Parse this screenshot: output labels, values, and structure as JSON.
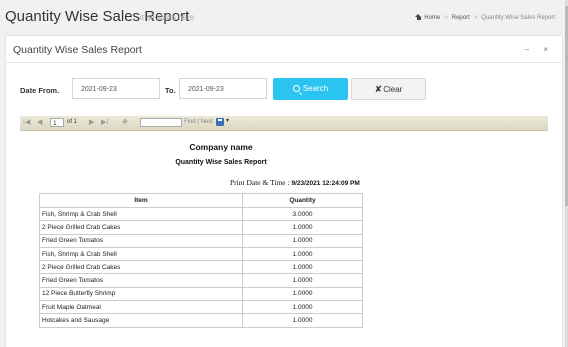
{
  "header": {
    "title": "Quantity Wise Sales Report",
    "subtitle": "it all starts here",
    "breadcrumb": [
      "Home",
      "Report",
      "Quantity Wise Sales Report"
    ]
  },
  "panel": {
    "title": "Quantity Wise Sales Report",
    "tools": "– ×"
  },
  "filters": {
    "date_from_label": "Date From.",
    "date_from_value": "2021-09-23",
    "to_label": "To.",
    "to_value": "2021-09-23",
    "search_label": "Search",
    "clear_label": "Clear"
  },
  "viewer": {
    "first": "I◀",
    "prev": "◀",
    "page": "1",
    "of_text": "of 1",
    "next": "▶",
    "last": "▶I",
    "refresh": "✥",
    "find_next": "Find | Next",
    "export_caret": "▾"
  },
  "report": {
    "company": "Company name",
    "title": "Quantity Wise Sales Report",
    "print_label": "Print Date & Time :",
    "print_value": "9/23/2021 12:24:09 PM",
    "columns": [
      "Item",
      "Quantity"
    ],
    "rows": [
      [
        "Fish, Shrimp & Crab Shell",
        "3.0000"
      ],
      [
        "2 Piece Grilled Crab Cakes",
        "1.0000"
      ],
      [
        "Fried Green Tomatos",
        "1.0000"
      ],
      [
        "Fish, Shrimp & Crab Shell",
        "1.0000"
      ],
      [
        "2 Piece Grilled Crab Cakes",
        "1.0000"
      ],
      [
        "Fried Green Tomatos",
        "1.0000"
      ],
      [
        "12 Piece Butterfly Shrimp",
        "1.0000"
      ],
      [
        "Fruit Maple Oatmeal",
        "1.0000"
      ],
      [
        "Hotcakes and Sausage",
        "1.0000"
      ]
    ]
  }
}
